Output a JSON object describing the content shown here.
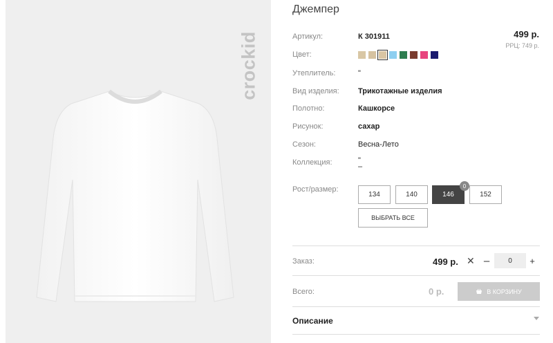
{
  "product": {
    "brand": "crockid",
    "title": "Джемпер",
    "price": "499 р.",
    "rrp": "РРЦ: 749 р."
  },
  "attributes": {
    "article_label": "Артикул:",
    "article_value": "К 301911",
    "color_label": "Цвет:",
    "insulation_label": "Утеплитель:",
    "insulation_value": "\"",
    "type_label": "Вид изделия:",
    "type_value": "Трикотажные изделия",
    "fabric_label": "Полотно:",
    "fabric_value": "Кашкорсе",
    "pattern_label": "Рисунок:",
    "pattern_value": "сахар",
    "season_label": "Сезон:",
    "season_value": "Весна-Лето",
    "collection_label": "Коллекция:",
    "collection_value_1": "\"",
    "collection_value_2": "–",
    "size_label": "Рост/размер:"
  },
  "colors": [
    "#d9c7a5",
    "#d6c2a0",
    "#d9c5a3",
    "#8ecff0",
    "#2e7d4f",
    "#7a3b2e",
    "#e8457e",
    "#1a1a6e"
  ],
  "sizes": [
    "134",
    "140",
    "146",
    "152"
  ],
  "selected_size": "146",
  "size_badge": "0",
  "select_all_label": "ВЫБРАТЬ ВСЕ",
  "order": {
    "label": "Заказ:",
    "price": "499 р.",
    "times": "✕",
    "minus": "–",
    "quantity": "0",
    "plus": "+"
  },
  "total": {
    "label": "Всего:",
    "value": "0 р.",
    "cart_label": "В КОРЗИНУ"
  },
  "description_label": "Описание"
}
